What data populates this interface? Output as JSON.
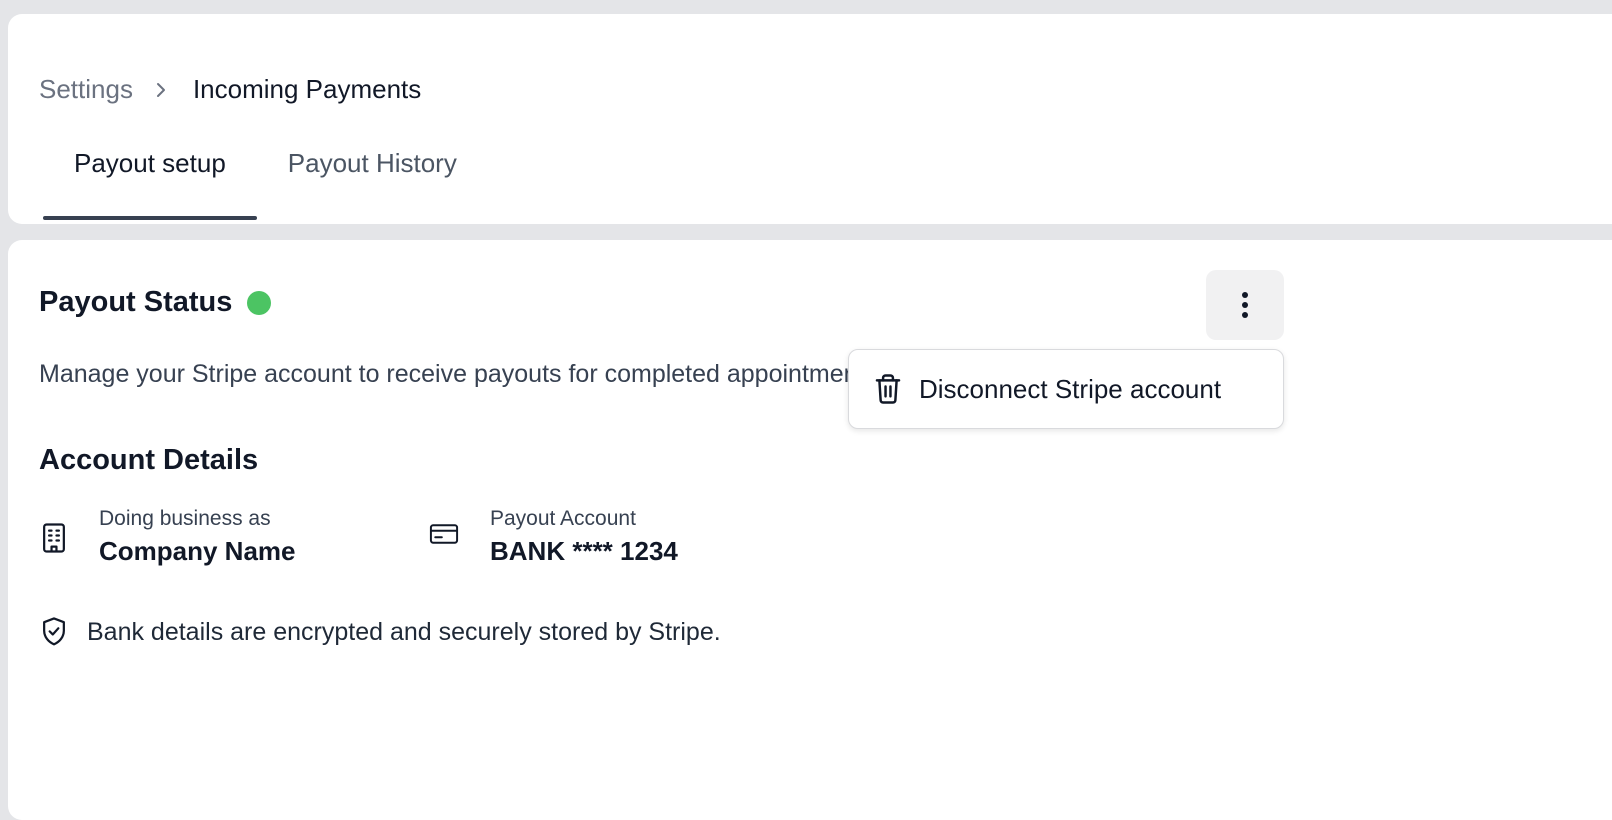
{
  "breadcrumb": {
    "parent": "Settings",
    "current": "Incoming Payments"
  },
  "tabs": [
    {
      "label": "Payout setup",
      "active": true
    },
    {
      "label": "Payout History",
      "active": false
    }
  ],
  "payout_status": {
    "title": "Payout Status",
    "status_color": "#4cc463",
    "description": "Manage your Stripe account to receive payouts for completed appointments."
  },
  "menu": {
    "icon": "more-vertical-icon",
    "items": [
      {
        "label": "Disconnect Stripe account",
        "icon": "trash-icon"
      }
    ]
  },
  "account_details": {
    "title": "Account Details",
    "business": {
      "label": "Doing business as",
      "value": "Company Name",
      "icon": "building-icon"
    },
    "payout_account": {
      "label": "Payout Account",
      "value": "BANK **** 1234",
      "icon": "credit-card-icon"
    }
  },
  "security_note": {
    "text": "Bank details are encrypted and securely stored by Stripe.",
    "icon": "shield-check-icon"
  }
}
